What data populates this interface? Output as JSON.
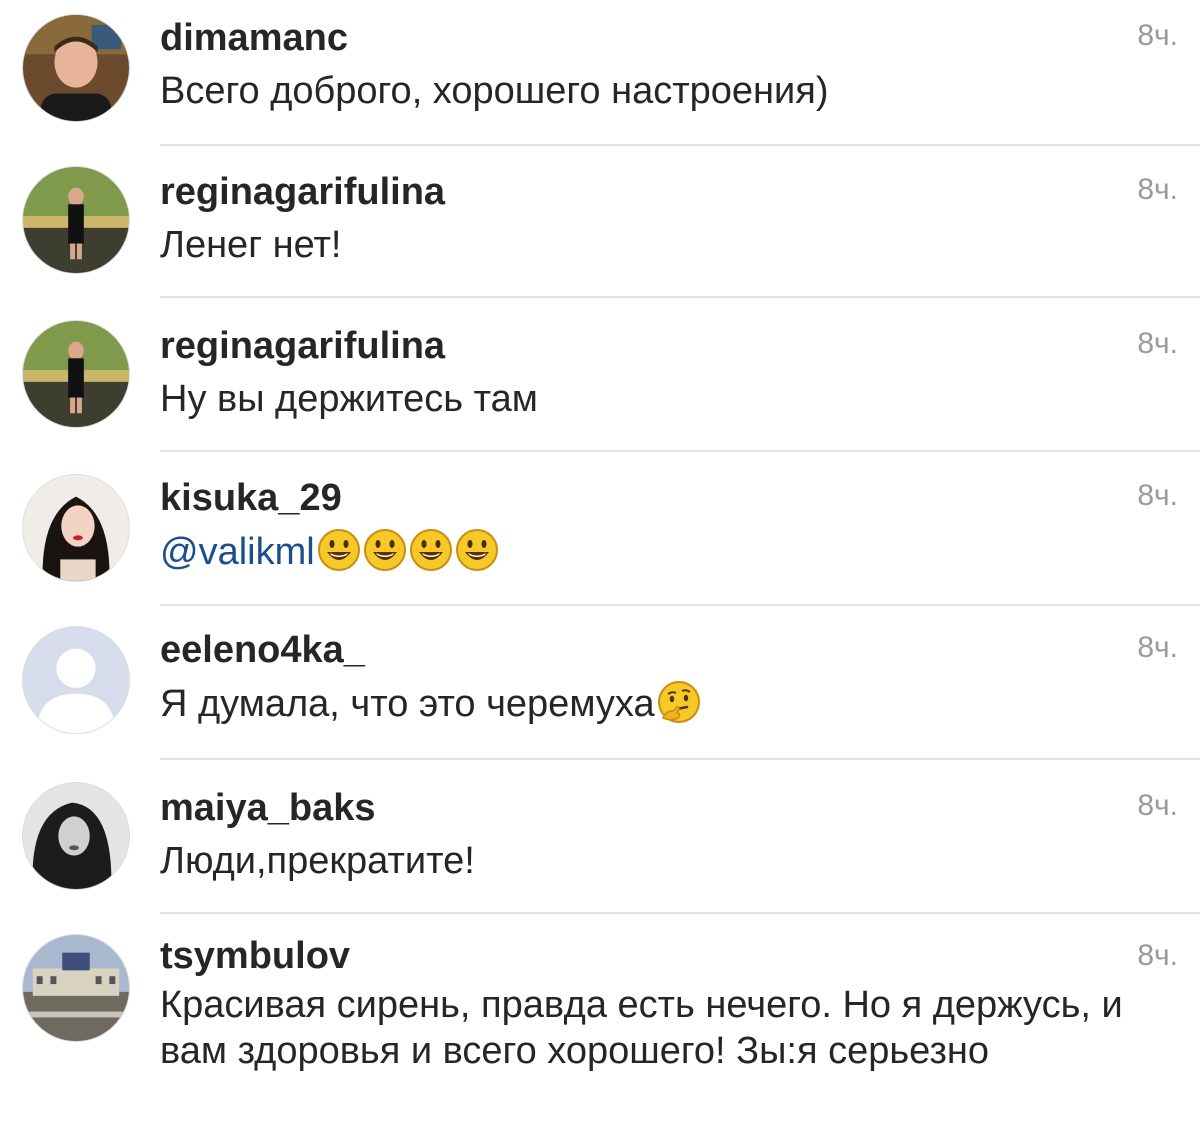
{
  "comments": [
    {
      "username": "dimamanc",
      "text": "Всего доброго, хорошего настроения)",
      "time": "8ч.",
      "avatar_icon": "user-photo-avatar"
    },
    {
      "username": "reginagarifulina",
      "text": "Ленег нет!",
      "time": "8ч.",
      "avatar_icon": "user-photo-avatar"
    },
    {
      "username": "reginagarifulina",
      "text": "Ну вы держитесь там",
      "time": "8ч.",
      "avatar_icon": "user-photo-avatar"
    },
    {
      "username": "kisuka_29",
      "mention": "@valikml",
      "emojis": [
        "smiley-emoji",
        "smiley-emoji",
        "smiley-emoji",
        "smiley-emoji"
      ],
      "time": "8ч.",
      "avatar_icon": "user-photo-avatar"
    },
    {
      "username": "eeleno4ka_",
      "text": "Я думала, что это черемуха",
      "emojis": [
        "thinking-emoji"
      ],
      "time": "8ч.",
      "avatar_icon": "default-user-avatar"
    },
    {
      "username": "maiya_baks",
      "text": "Люди,прекратите!",
      "time": "8ч.",
      "avatar_icon": "user-photo-avatar"
    },
    {
      "username": "tsymbulov",
      "text": "Красивая сирень, правда есть нечего. Но я держусь, и вам здоровья и всего хорошего! Зы:я серьезно",
      "time": "8ч.",
      "avatar_icon": "user-photo-avatar"
    }
  ],
  "colors": {
    "text": "#262626",
    "mention": "#1a4e8c",
    "timestamp": "#9a9a9a",
    "divider": "#e3e3e3"
  }
}
